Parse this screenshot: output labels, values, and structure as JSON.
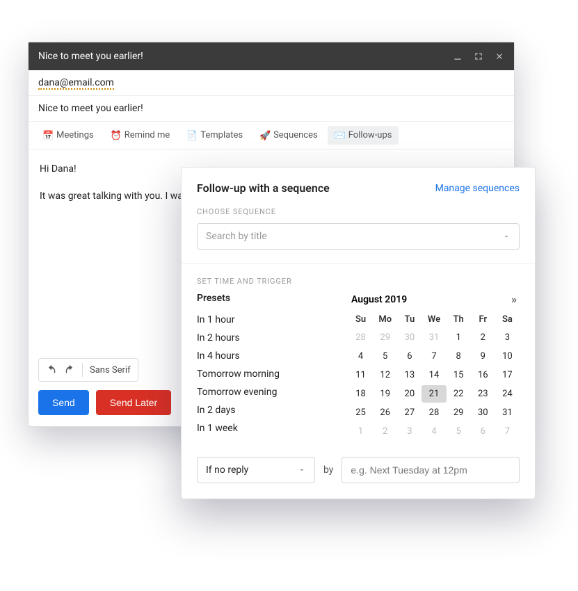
{
  "window": {
    "title": "Nice to meet you earlier!"
  },
  "fields": {
    "to": "dana@email.com",
    "subject": "Nice to meet you earlier!"
  },
  "tabs": {
    "meetings": "Meetings",
    "remind": "Remind me",
    "templates": "Templates",
    "sequences": "Sequences",
    "followups": "Follow-ups"
  },
  "body": {
    "greeting": "Hi Dana!",
    "line1": "It was great talking with you. I was thinking about what you said and would you mind taking a look at"
  },
  "toolbar": {
    "font": "Sans Serif"
  },
  "buttons": {
    "send": "Send",
    "send_later": "Send Later"
  },
  "popover": {
    "title": "Follow-up with a sequence",
    "manage": "Manage sequences",
    "choose_label": "CHOOSE SEQUENCE",
    "search_placeholder": "Search by title",
    "set_time_label": "SET TIME AND TRIGGER",
    "presets_title": "Presets",
    "presets": [
      "In 1 hour",
      "In 2 hours",
      "In 4 hours",
      "Tomorrow morning",
      "Tomorrow evening",
      "In 2 days",
      "In 1 week"
    ],
    "calendar": {
      "month_label": "August 2019",
      "dow": [
        "Su",
        "Mo",
        "Tu",
        "We",
        "Th",
        "Fr",
        "Sa"
      ],
      "days": [
        {
          "n": "28",
          "muted": true
        },
        {
          "n": "29",
          "muted": true
        },
        {
          "n": "30",
          "muted": true
        },
        {
          "n": "31",
          "muted": true
        },
        {
          "n": "1"
        },
        {
          "n": "2"
        },
        {
          "n": "3"
        },
        {
          "n": "4"
        },
        {
          "n": "5"
        },
        {
          "n": "6"
        },
        {
          "n": "7"
        },
        {
          "n": "8"
        },
        {
          "n": "9"
        },
        {
          "n": "10"
        },
        {
          "n": "11"
        },
        {
          "n": "12"
        },
        {
          "n": "13"
        },
        {
          "n": "14"
        },
        {
          "n": "15"
        },
        {
          "n": "16"
        },
        {
          "n": "17"
        },
        {
          "n": "18"
        },
        {
          "n": "19"
        },
        {
          "n": "20"
        },
        {
          "n": "21",
          "selected": true
        },
        {
          "n": "22"
        },
        {
          "n": "23"
        },
        {
          "n": "24"
        },
        {
          "n": "25"
        },
        {
          "n": "26"
        },
        {
          "n": "27"
        },
        {
          "n": "28"
        },
        {
          "n": "29"
        },
        {
          "n": "30"
        },
        {
          "n": "31"
        },
        {
          "n": "1",
          "muted": true
        },
        {
          "n": "2",
          "muted": true
        },
        {
          "n": "3",
          "muted": true
        },
        {
          "n": "4",
          "muted": true
        },
        {
          "n": "5",
          "muted": true
        },
        {
          "n": "6",
          "muted": true
        },
        {
          "n": "7",
          "muted": true
        }
      ]
    },
    "trigger": {
      "condition": "If no reply",
      "by_label": "by",
      "time_placeholder": "e.g. Next Tuesday at 12pm"
    }
  }
}
